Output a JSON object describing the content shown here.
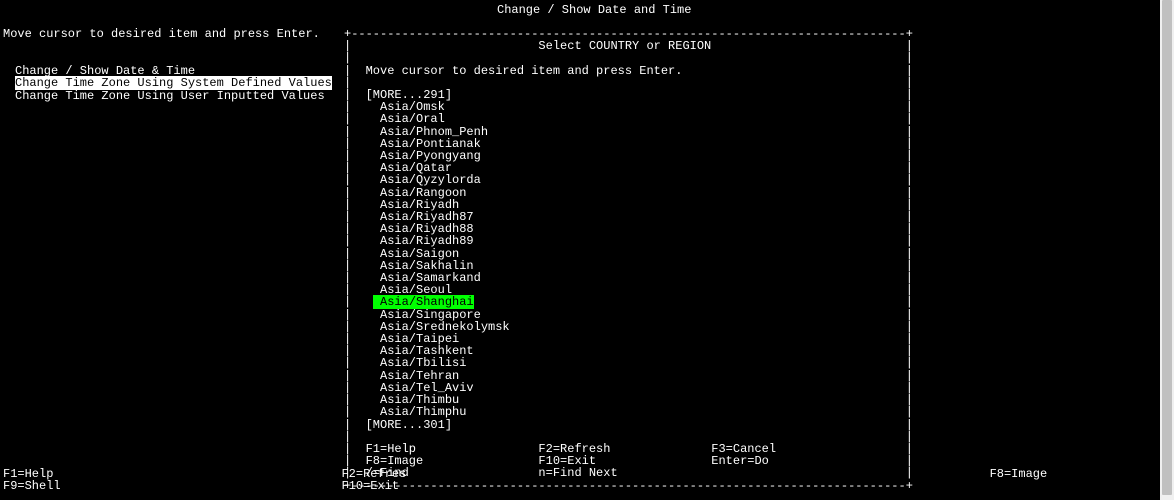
{
  "header": {
    "title": "Change / Show Date and Time"
  },
  "main": {
    "instruction": "Move cursor to desired item and press Enter."
  },
  "menu": {
    "items": [
      "Change / Show Date & Time",
      "Change Time Zone Using System Defined Values",
      "Change Time Zone Using User Inputted Values"
    ],
    "selectedIndex": 1
  },
  "dialog": {
    "title": "Select COUNTRY or REGION",
    "instruction": "Move cursor to desired item and press Enter.",
    "moreTop": "[MORE...291]",
    "moreBottom": "[MORE...301]",
    "items": [
      "Asia/Omsk",
      "Asia/Oral",
      "Asia/Phnom_Penh",
      "Asia/Pontianak",
      "Asia/Pyongyang",
      "Asia/Qatar",
      "Asia/Qyzylorda",
      "Asia/Rangoon",
      "Asia/Riyadh",
      "Asia/Riyadh87",
      "Asia/Riyadh88",
      "Asia/Riyadh89",
      "Asia/Saigon",
      "Asia/Sakhalin",
      "Asia/Samarkand",
      "Asia/Seoul",
      "Asia/Shanghai",
      "Asia/Singapore",
      "Asia/Srednekolymsk",
      "Asia/Taipei",
      "Asia/Tashkent",
      "Asia/Tbilisi",
      "Asia/Tehran",
      "Asia/Tel_Aviv",
      "Asia/Thimbu",
      "Asia/Thimphu"
    ],
    "selectedIndex": 16,
    "keys": {
      "row1": {
        "f1": "F1=Help",
        "f2": "F2=Refresh",
        "f3": "F3=Cancel"
      },
      "row2": {
        "f8": "F8=Image",
        "f10": "F10=Exit",
        "enter": "Enter=Do"
      },
      "row3": {
        "find": "/=Find",
        "findnext": "n=Find Next"
      }
    }
  },
  "bottomKeys": {
    "row1": {
      "f1": "F1=Help",
      "f2": "F2=Refres",
      "f8": "F8=Image"
    },
    "row2": {
      "f9": "F9=Shell",
      "f10": "F10=Exit"
    }
  }
}
